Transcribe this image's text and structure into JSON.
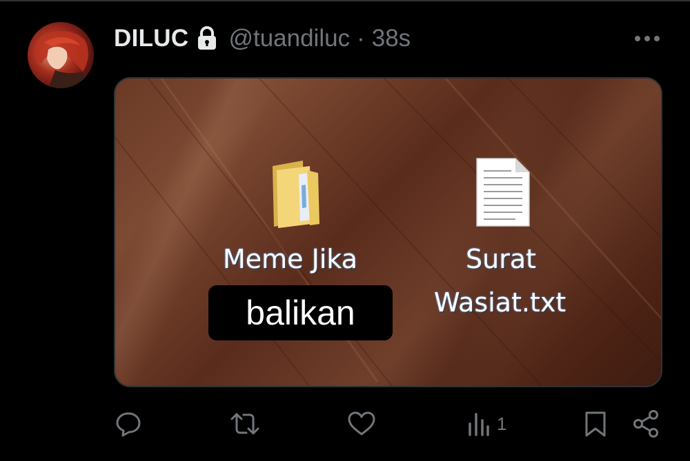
{
  "tweet": {
    "display_name": "DILUC",
    "handle": "@tuandiluc",
    "separator": "·",
    "time": "38s",
    "protected_icon": "lock-icon",
    "more_icon": "more-dots-icon"
  },
  "media": {
    "folder": {
      "icon": "folder-icon",
      "label_line1": "Meme Jika",
      "label_line2": "balikan"
    },
    "file": {
      "icon": "text-file-icon",
      "label_line1": "Surat",
      "label_line2": "Wasiat.txt"
    }
  },
  "actions": {
    "reply_icon": "reply-icon",
    "retweet_icon": "retweet-icon",
    "like_icon": "heart-icon",
    "views_icon": "views-icon",
    "views_count": "1",
    "bookmark_icon": "bookmark-icon",
    "share_icon": "share-icon"
  },
  "colors": {
    "background": "#000000",
    "primary_text": "#e7e9ea",
    "secondary_text": "#71767b",
    "border": "#2f3336"
  }
}
